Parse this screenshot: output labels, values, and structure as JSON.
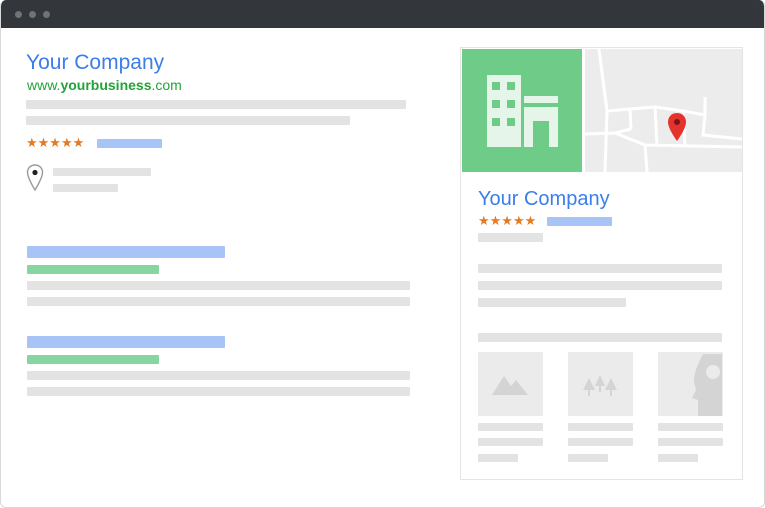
{
  "window": {
    "title": ""
  },
  "result": {
    "company_name": "Your Company",
    "url_prefix": "www.",
    "url_bold": "yourbusiness",
    "url_suffix": ".com",
    "rating_stars": "★★★★★",
    "rating": 5
  },
  "panel": {
    "company_name": "Your Company",
    "rating_stars": "★★★★★",
    "rating": 5
  },
  "colors": {
    "link_blue": "#3b7dea",
    "url_green": "#22a339",
    "star_orange": "#e37b22",
    "placeholder_gray": "#e3e3e3",
    "placeholder_blue": "#a8c4f6",
    "placeholder_green": "#87d5a0",
    "brand_green": "#6fcb88",
    "map_pin_red": "#e5322d",
    "titlebar": "#33373b"
  },
  "icons": [
    "location-pin-icon",
    "building-icon",
    "map-pin-icon",
    "image-mountain-icon",
    "image-trees-icon",
    "image-person-icon"
  ]
}
